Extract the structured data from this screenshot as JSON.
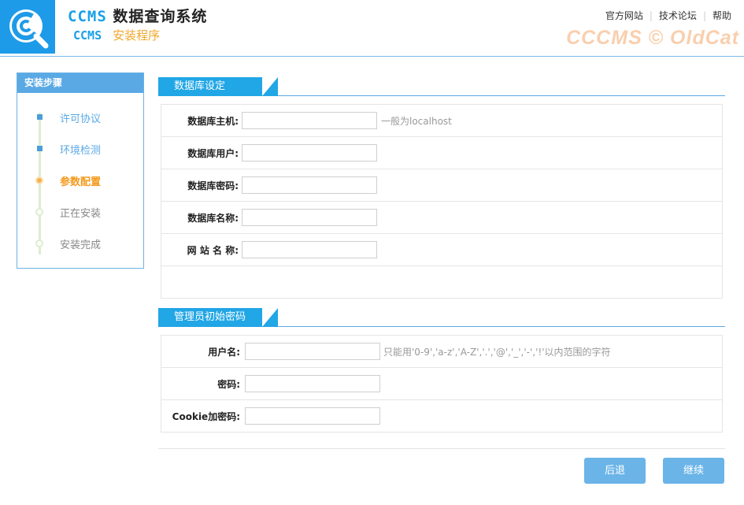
{
  "header": {
    "brand_main_ccms": "CCMS",
    "brand_main_zh": "数据查询系统",
    "brand_sub_ccms": "CCMS",
    "brand_sub_zh": "安装程序",
    "watermark": "CCCMS © OldCat",
    "links": [
      "官方网站",
      "技术论坛",
      "帮助"
    ]
  },
  "sidebar": {
    "title": "安装步骤",
    "steps": [
      {
        "label": "许可协议",
        "state": "done"
      },
      {
        "label": "环境检测",
        "state": "done"
      },
      {
        "label": "参数配置",
        "state": "active"
      },
      {
        "label": "正在安装",
        "state": "todo"
      },
      {
        "label": "安装完成",
        "state": "todo"
      }
    ]
  },
  "db_section": {
    "title": "数据库设定",
    "fields": [
      {
        "label": "数据库主机:",
        "value": "",
        "hint": "一般为localhost"
      },
      {
        "label": "数据库用户:",
        "value": ""
      },
      {
        "label": "数据库密码:",
        "value": ""
      },
      {
        "label": "数据库名称:",
        "value": ""
      },
      {
        "label": "网 站 名 称:",
        "value": ""
      }
    ]
  },
  "admin_section": {
    "title": "管理员初始密码",
    "fields": [
      {
        "label": "用户名:",
        "value": "",
        "hint": "只能用'0-9','a-z','A-Z','.','@','_','-','!'以内范围的字符"
      },
      {
        "label": "密码:",
        "value": ""
      },
      {
        "label": "Cookie加密码:",
        "value": ""
      }
    ]
  },
  "buttons": {
    "back": "后退",
    "next": "继续"
  },
  "colors": {
    "accent": "#21a6e6",
    "active_step": "#f39a1f",
    "button": "#6ab4e8",
    "watermark": "#f9cfae"
  }
}
